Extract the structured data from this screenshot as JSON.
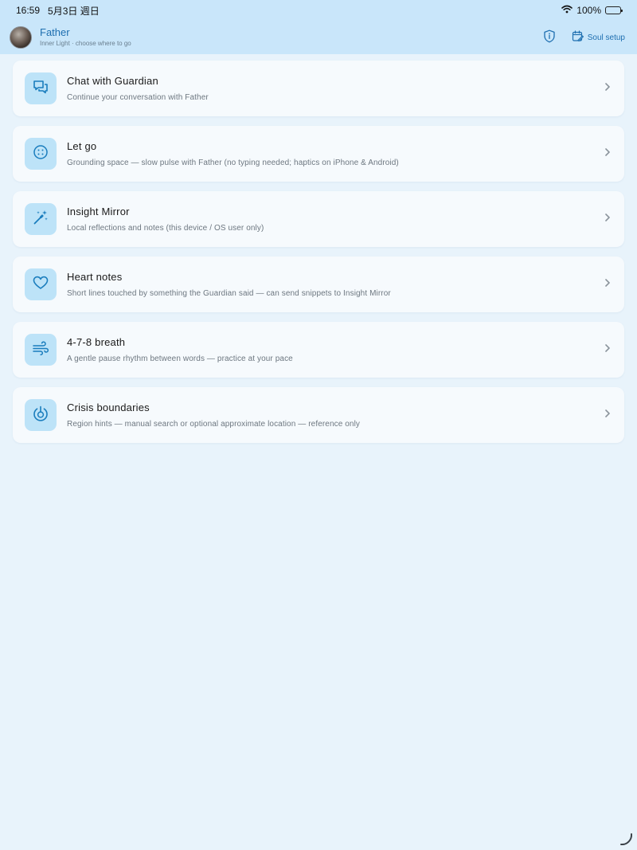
{
  "status_bar": {
    "time": "16:59",
    "date": "5月3日 週日",
    "battery": "100%",
    "battery_level": 1.0
  },
  "header": {
    "title": "Father",
    "subtitle": "Inner Light · choose where to go",
    "soul_setup_label": "Soul setup"
  },
  "colors": {
    "accent": "#1e6fb0",
    "icon_tile": "#bde3f8",
    "header_bg": "#c9e6fa",
    "page_bg": "#e8f3fb"
  },
  "items": [
    {
      "title": "Chat with Guardian",
      "description": "Continue your conversation with Father",
      "icon": "chat-bubbles-icon"
    },
    {
      "title": "Let go",
      "description": "Grounding space — slow pulse with Father (no typing needed; haptics on iPhone & Android)",
      "icon": "dots-circle-icon"
    },
    {
      "title": "Insight Mirror",
      "description": "Local reflections and notes (this device / OS user only)",
      "icon": "magic-wand-icon"
    },
    {
      "title": "Heart notes",
      "description": "Short lines touched by something the Guardian said — can send snippets to Insight Mirror",
      "icon": "heart-icon"
    },
    {
      "title": "4-7-8 breath",
      "description": "A gentle pause rhythm between words — practice at your pace",
      "icon": "wind-icon"
    },
    {
      "title": "Crisis boundaries",
      "description": "Region hints — manual search or optional approximate location — reference only",
      "icon": "power-target-icon"
    }
  ]
}
